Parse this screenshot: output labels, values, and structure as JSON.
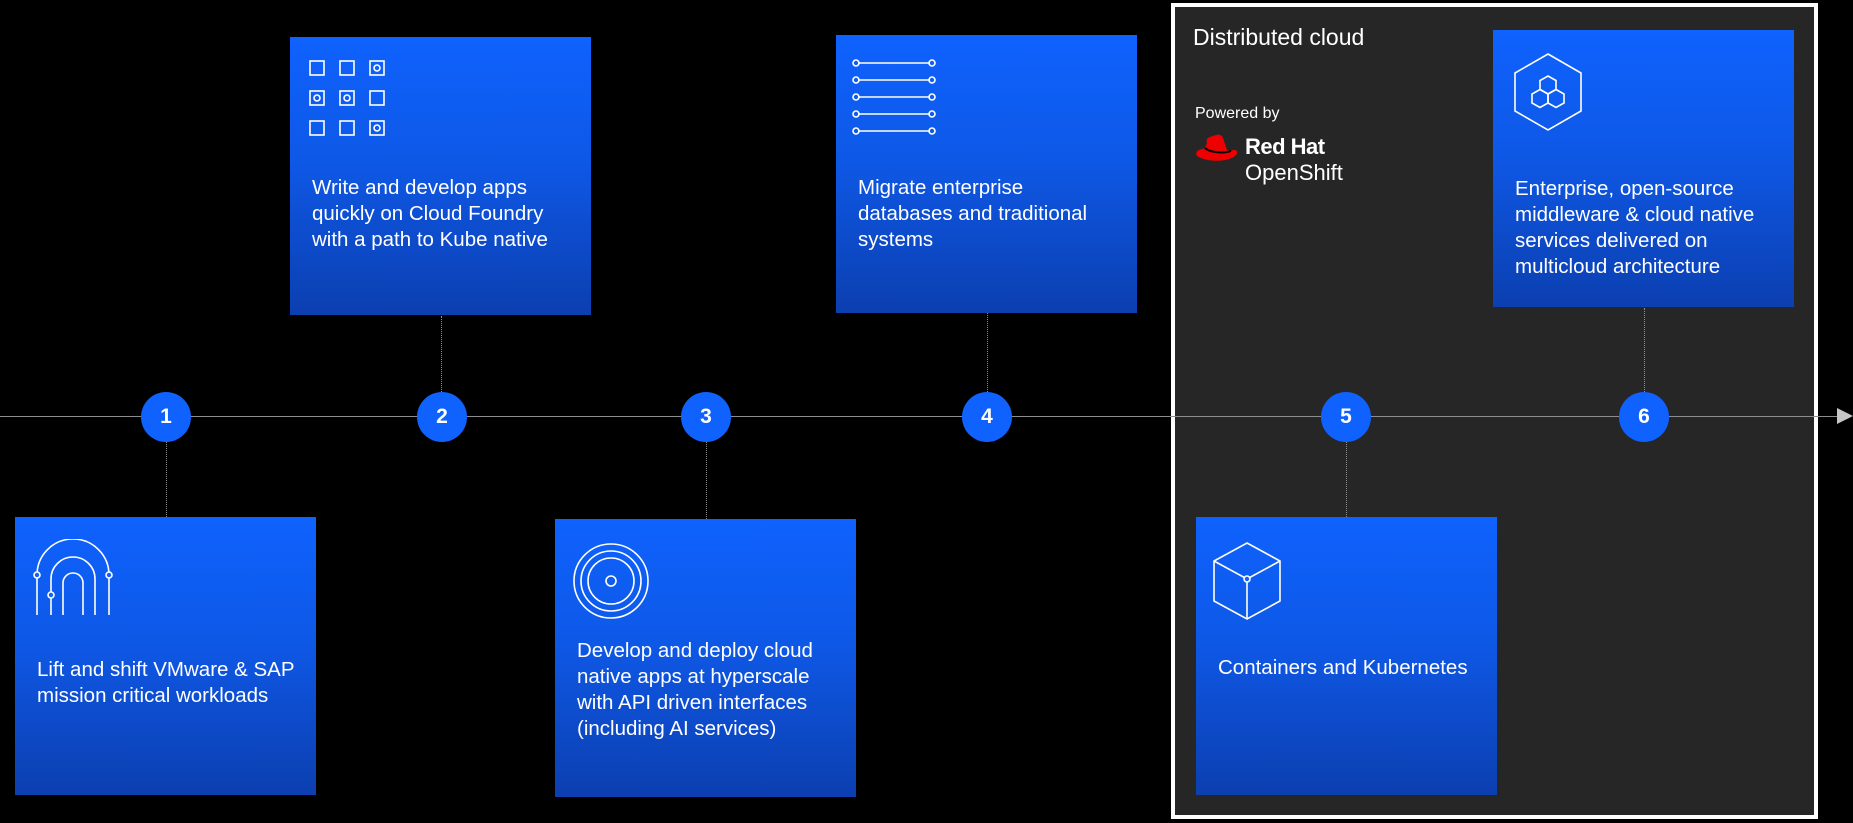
{
  "distributed_cloud": {
    "title": "Distributed cloud",
    "powered_by": "Powered by",
    "logo_line1": "Red Hat",
    "logo_line2": "OpenShift"
  },
  "markers": [
    "1",
    "2",
    "3",
    "4",
    "5",
    "6"
  ],
  "cards": [
    {
      "id": "lift-shift",
      "icon": "fingerprint-arch-icon",
      "text": "Lift and shift VMware & SAP mission critical workloads"
    },
    {
      "id": "cloud-foundry",
      "icon": "grid-squares-icon",
      "text": "Write and develop apps quickly on Cloud Foundry with a path to Kube native"
    },
    {
      "id": "cloud-native",
      "icon": "concentric-circles-icon",
      "text": "Develop and deploy cloud native apps at hyperscale with API driven interfaces (including AI services)"
    },
    {
      "id": "migrate-databases",
      "icon": "list-lines-icon",
      "text": "Migrate enterprise databases and traditional systems"
    },
    {
      "id": "containers",
      "icon": "cube-icon",
      "text": "Containers and Kubernetes"
    },
    {
      "id": "middleware",
      "icon": "hexagon-cluster-icon",
      "text": "Enterprise, open-source middleware & cloud native services delivered on multicloud architecture"
    }
  ],
  "colors": {
    "accent": "#0f62fe",
    "panel": "#262626",
    "background": "#000000",
    "line": "#8d8d8d",
    "logo_red": "#ee0000"
  }
}
